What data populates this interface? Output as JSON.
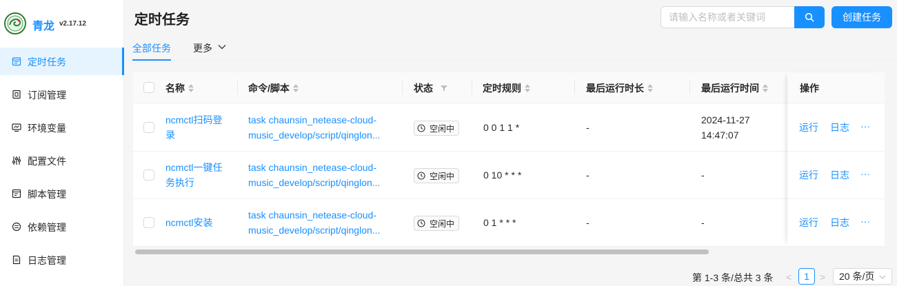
{
  "brand": {
    "name": "青龙",
    "version": "v2.17.12"
  },
  "sidebar": {
    "items": [
      {
        "label": "定时任务",
        "icon": "calendar-icon",
        "active": true
      },
      {
        "label": "订阅管理",
        "icon": "subscription-icon"
      },
      {
        "label": "环境变量",
        "icon": "monitor-icon"
      },
      {
        "label": "配置文件",
        "icon": "sliders-icon"
      },
      {
        "label": "脚本管理",
        "icon": "script-icon"
      },
      {
        "label": "依赖管理",
        "icon": "dependency-icon"
      },
      {
        "label": "日志管理",
        "icon": "log-icon"
      }
    ]
  },
  "header": {
    "title": "定时任务",
    "search_placeholder": "请输入名称或者关键词",
    "create_label": "创建任务"
  },
  "tabs": {
    "all": "全部任务",
    "more": "更多"
  },
  "table": {
    "columns": {
      "name": "名称",
      "command": "命令/脚本",
      "status": "状态",
      "schedule": "定时规则",
      "last_duration": "最后运行时长",
      "last_time": "最后运行时间",
      "actions": "操作"
    },
    "rows": [
      {
        "name_l1": "ncmctl扫码登",
        "name_l2": "录",
        "cmd_l1": "task chaunsin_netease-cloud-",
        "cmd_l2": "music_develop/script/qinglon...",
        "status": "空闲中",
        "schedule": "0 0 1 1 *",
        "last_duration": "-",
        "last_time_l1": "2024-11-27",
        "last_time_l2": "14:47:07",
        "run": "运行",
        "log": "日志",
        "more": "···"
      },
      {
        "name_l1": "ncmctl一键任",
        "name_l2": "务执行",
        "cmd_l1": "task chaunsin_netease-cloud-",
        "cmd_l2": "music_develop/script/qinglon...",
        "status": "空闲中",
        "schedule": "0 10 * * *",
        "last_duration": "-",
        "last_time_l1": "-",
        "last_time_l2": "",
        "run": "运行",
        "log": "日志",
        "more": "···"
      },
      {
        "name_l1": "ncmctl安装",
        "name_l2": "",
        "cmd_l1": "task chaunsin_netease-cloud-",
        "cmd_l2": "music_develop/script/qinglon...",
        "status": "空闲中",
        "schedule": "0 1 * * *",
        "last_duration": "-",
        "last_time_l1": "-",
        "last_time_l2": "",
        "run": "运行",
        "log": "日志",
        "more": "···"
      }
    ]
  },
  "pagination": {
    "total": "第 1-3 条/总共 3 条",
    "prev": "<",
    "current": "1",
    "next": ">",
    "page_size": "20 条/页"
  },
  "colors": {
    "primary": "#1890ff"
  }
}
